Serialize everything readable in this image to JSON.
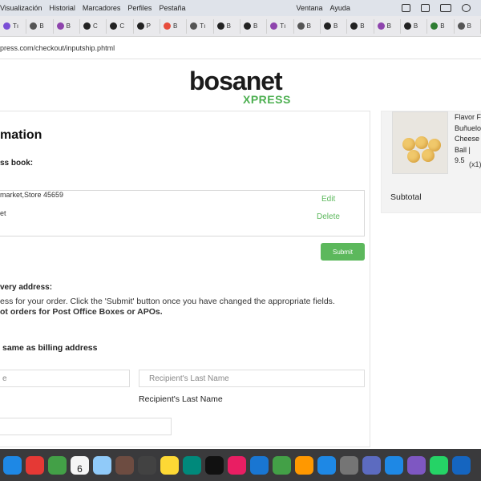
{
  "menubar": {
    "items": [
      "Visualización",
      "Historial",
      "Marcadores",
      "Perfiles",
      "Pestaña",
      "Ventana",
      "Ayuda"
    ]
  },
  "tabs": [
    {
      "label": "Tı",
      "color": "#7b4fd6"
    },
    {
      "label": "B",
      "color": "#555555"
    },
    {
      "label": "B",
      "color": "#8e44ad"
    },
    {
      "label": "C",
      "color": "#222222"
    },
    {
      "label": "C",
      "color": "#222222"
    },
    {
      "label": "P",
      "color": "#222222"
    },
    {
      "label": "B",
      "color": "#e74c3c"
    },
    {
      "label": "Tı",
      "color": "#555555"
    },
    {
      "label": "B",
      "color": "#222222"
    },
    {
      "label": "B",
      "color": "#222222"
    },
    {
      "label": "Tı",
      "color": "#8e44ad"
    },
    {
      "label": "B",
      "color": "#555555"
    },
    {
      "label": "B",
      "color": "#222222"
    },
    {
      "label": "B",
      "color": "#222222"
    },
    {
      "label": "B",
      "color": "#8e44ad"
    },
    {
      "label": "B",
      "color": "#222222"
    },
    {
      "label": "B",
      "color": "#2e7d32"
    },
    {
      "label": "B",
      "color": "#555555"
    }
  ],
  "url": "press.com/checkout/inputship.phtml",
  "brand": {
    "name": "bosanet",
    "sub": "XPRESS"
  },
  "form": {
    "title": "mation",
    "address_book_label": "ss book:",
    "address_line1": "market,Store 45659",
    "address_line2": "et",
    "edit_label": "Edit",
    "delete_label": "Delete",
    "submit_label": "Submit",
    "delivery_label": "very address:",
    "instructions": "ess for your order. Click the 'Submit' button once you have changed the appropriate fields.",
    "po_note": "ot orders for Post Office Boxes or APOs.",
    "same_as_billing": "same as billing address",
    "first_name_placeholder": "e",
    "last_name_placeholder": "Recipient's Last Name",
    "last_name_label": "Recipient's Last Name"
  },
  "sidebar": {
    "product_title_lines": [
      "Flavor F",
      "Buñuelo",
      "Cheese",
      "Ball | 9.5"
    ],
    "quantity": "(x1)",
    "subtotal_label": "Subtotal"
  },
  "dock": {
    "calendar_day": "6",
    "apps": [
      "#1e88e5",
      "#e53935",
      "#43a047",
      "#3a3a3c",
      "#90caf9",
      "#6d4c41",
      "#424242",
      "#fdd835",
      "#00897b",
      "#111111",
      "#e91e63",
      "#1976d2",
      "#43a047",
      "#ff9800",
      "#1e88e5",
      "#757575",
      "#5c6bc0",
      "#1e88e5",
      "#7e57c2",
      "#25d366",
      "#1565c0"
    ]
  }
}
